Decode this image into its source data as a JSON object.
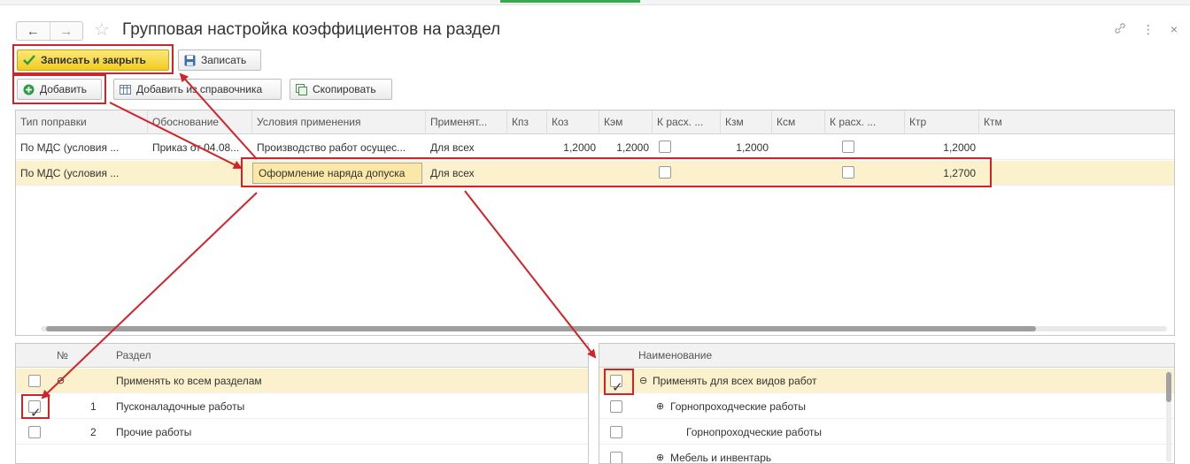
{
  "window": {
    "title": "Групповая настройка коэффициентов на раздел",
    "nav_back": "←",
    "nav_forward": "→",
    "star": "☆",
    "link_icon": "🔗",
    "menu_icon": "⋮",
    "close_icon": "×"
  },
  "toolbar": {
    "save_close": "Записать и закрыть",
    "save": "Записать",
    "add": "Добавить",
    "add_from_ref": "Добавить из справочника",
    "copy": "Скопировать"
  },
  "grid": {
    "columns": [
      "Тип поправки",
      "Обоснование",
      "Условия применения",
      "Применят...",
      "Кпз",
      "Коз",
      "Кэм",
      "К расх. ...",
      "Кзм",
      "Ксм",
      "К расх. ...",
      "Ктр",
      "Ктм"
    ],
    "rows": [
      {
        "type": "По МДС (условия ...",
        "basis": "Приказ от 04.08...",
        "conditions": "Производство работ осущес...",
        "applies": "Для всех",
        "kpz": "",
        "koz": "1,2000",
        "kem": "1,2000",
        "rash1": false,
        "kzm": "1,2000",
        "ksm": "",
        "rash2": false,
        "ktr": "1,2000",
        "ktm": ""
      },
      {
        "type": "По МДС (условия ...",
        "basis": "",
        "conditions": "Оформление наряда допуска",
        "applies": "Для всех",
        "kpz": "",
        "koz": "",
        "kem": "",
        "rash1": false,
        "kzm": "",
        "ksm": "",
        "rash2": false,
        "ktr": "1,2700",
        "ktm": ""
      }
    ]
  },
  "sections": {
    "header_no": "№",
    "header_section": "Раздел",
    "rows": [
      {
        "num": "",
        "name": "Применять ко всем разделам",
        "checked": false
      },
      {
        "num": "1",
        "name": "Пусконаладочные работы",
        "checked": true
      },
      {
        "num": "2",
        "name": "Прочие работы",
        "checked": false
      }
    ]
  },
  "work_types": {
    "header_name": "Наименование",
    "rows": [
      {
        "name": "Применять для всех видов работ",
        "checked": true,
        "marker": "⊖"
      },
      {
        "name": "Горнопроходческие работы",
        "checked": false,
        "marker": "⊕"
      },
      {
        "name": "Горнопроходческие работы",
        "checked": false,
        "marker": ""
      },
      {
        "name": "Мебель и инвентарь",
        "checked": false,
        "marker": "⊕"
      }
    ]
  },
  "colors": {
    "highlight_red": "#d2222a",
    "selected_row": "#fbf1cc",
    "primary_button": "#f2cc1f",
    "check_green": "#1f8c3a"
  }
}
